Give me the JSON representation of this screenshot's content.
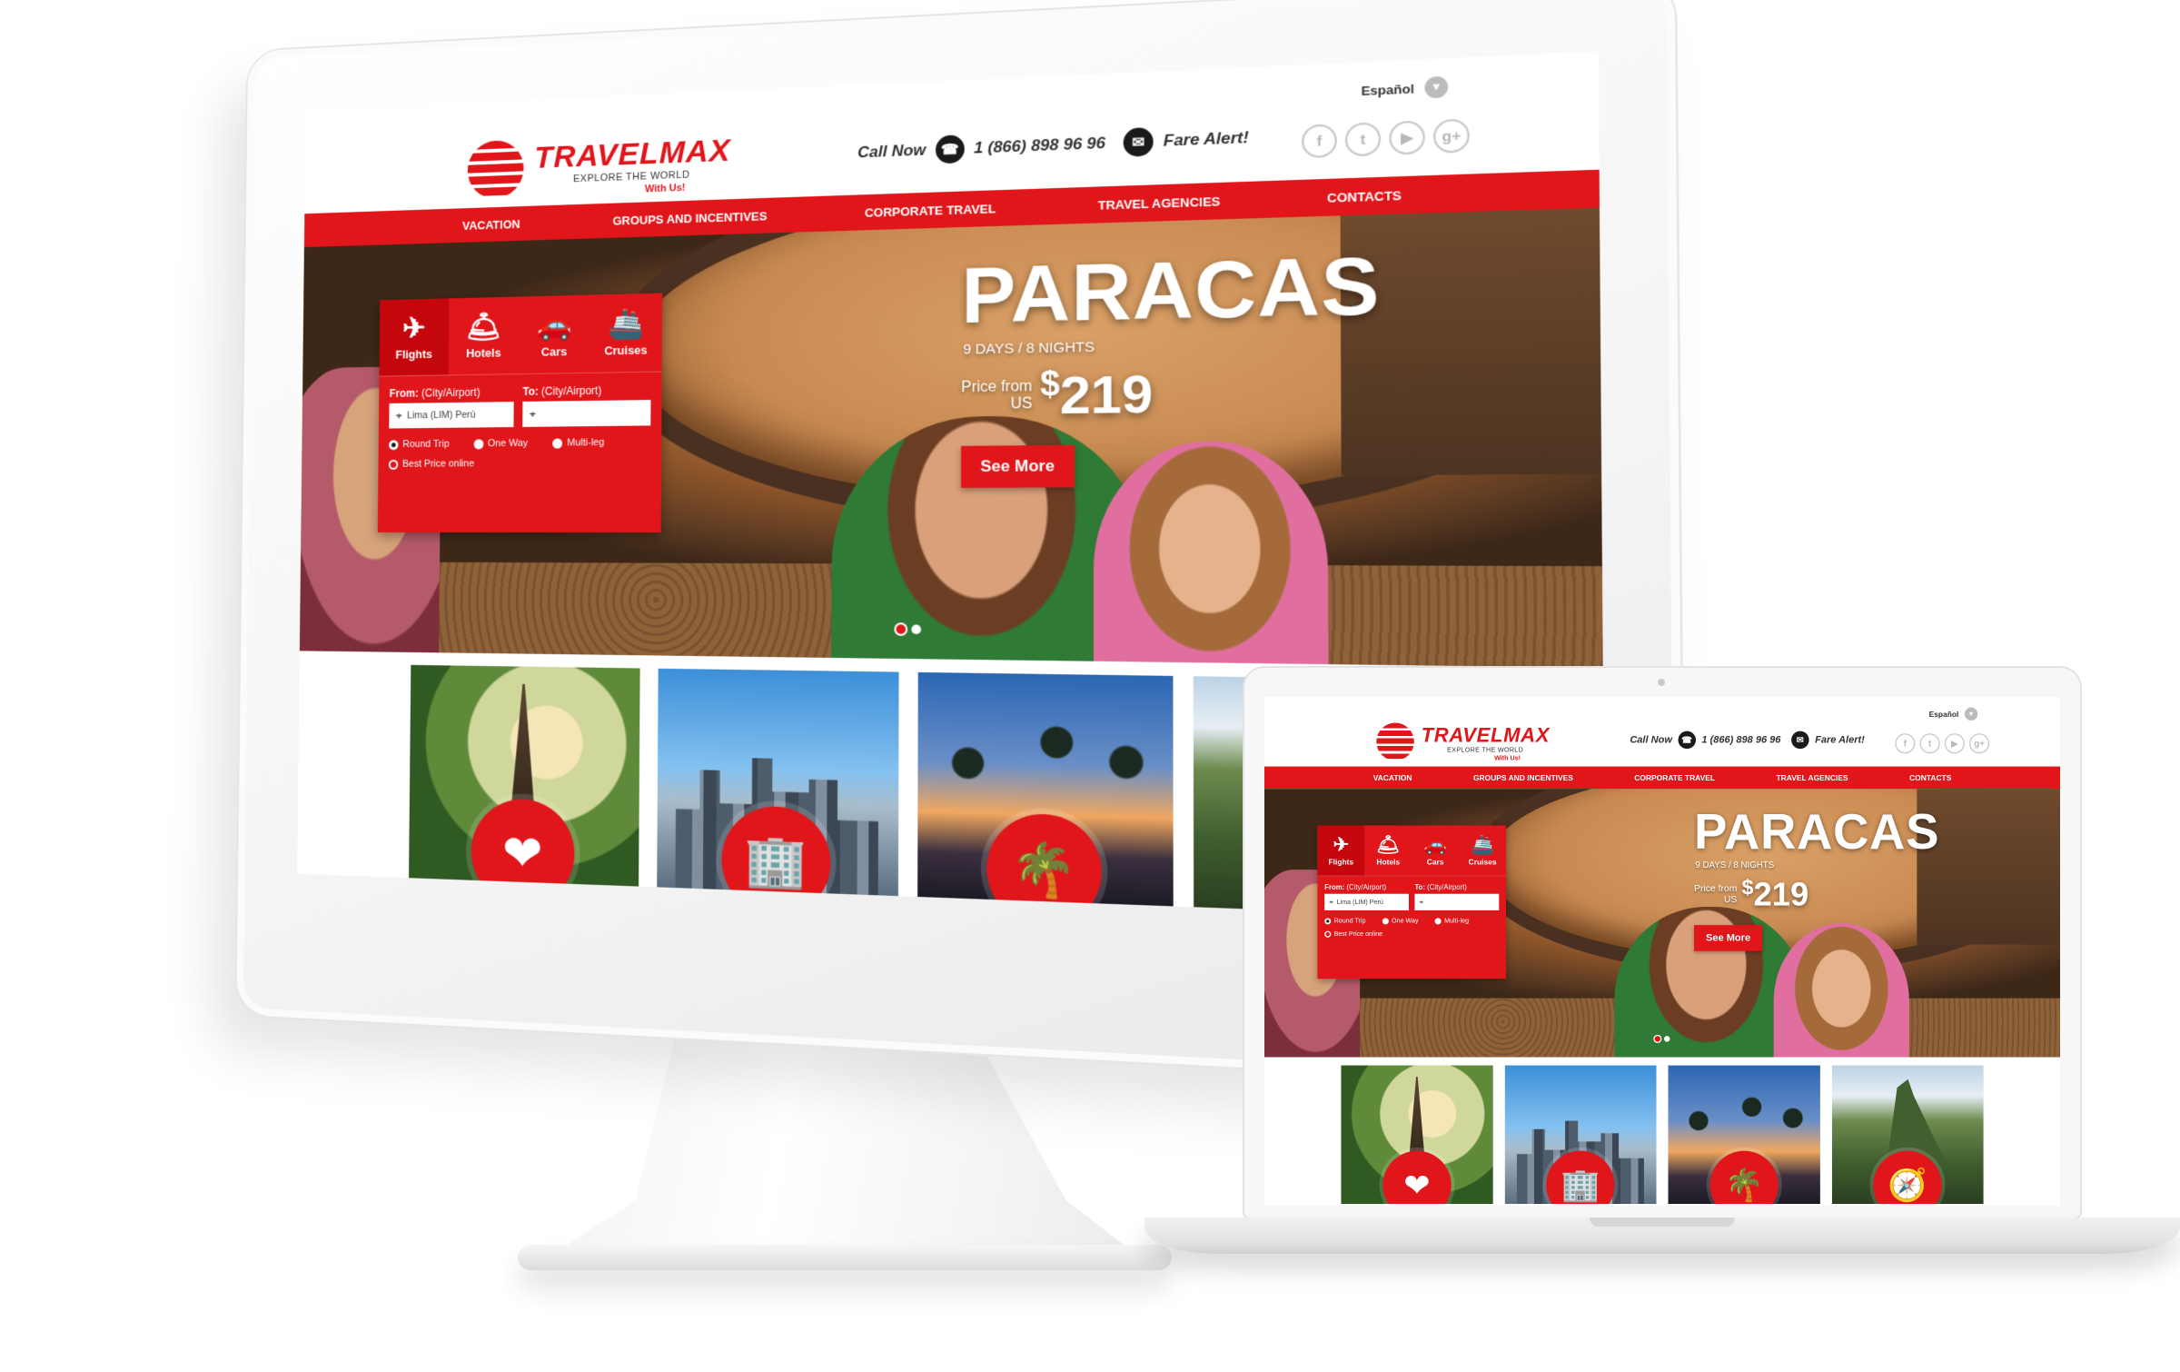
{
  "site": {
    "brand": "TRAVELMAX",
    "tagline": "EXPLORE THE WORLD",
    "tagline_suffix": "With Us!",
    "language": "Español",
    "call_label": "Call Now",
    "phone": "1 (866) 898 96 96",
    "fare_alert": "Fare Alert!",
    "socials": [
      "f",
      "t",
      "▶",
      "g+"
    ],
    "nav": [
      "VACATION",
      "GROUPS AND INCENTIVES",
      "CORPORATE TRAVEL",
      "TRAVEL AGENCIES",
      "CONTACTS"
    ],
    "hero": {
      "destination": "PARACAS",
      "duration": "9 DAYS / 8 NIGHTS",
      "price_prefix": "Price from",
      "currency_code": "US",
      "currency_symbol": "$",
      "price": "219",
      "cta": "See More"
    },
    "search": {
      "tabs": [
        {
          "label": "Flights",
          "icon": "plane-icon",
          "glyph": "✈",
          "active": true
        },
        {
          "label": "Hotels",
          "icon": "bell-icon",
          "glyph": "🛎",
          "active": false
        },
        {
          "label": "Cars",
          "icon": "car-icon",
          "glyph": "🚗",
          "active": false
        },
        {
          "label": "Cruises",
          "icon": "ship-icon",
          "glyph": "🚢",
          "active": false
        }
      ],
      "from_label": "From:",
      "from_hint": "(City/Airport)",
      "from_value": "Lima (LIM) Perú",
      "to_label": "To:",
      "to_hint": "(City/Airport)",
      "to_value": "",
      "trip_types": [
        "Round Trip",
        "One Way",
        "Multi-leg"
      ],
      "selected_trip": "Round Trip",
      "best_price": "Best Price online"
    },
    "slides": {
      "count": 2,
      "active": 1
    },
    "cards": [
      {
        "name": "paris",
        "icon": "hearts-icon",
        "glyph": "❤"
      },
      {
        "name": "new-york",
        "icon": "building-icon",
        "glyph": "🏢"
      },
      {
        "name": "beach",
        "icon": "palm-tree-icon",
        "glyph": "🌴"
      },
      {
        "name": "machu-picchu",
        "icon": "compass-icon",
        "glyph": "🧭"
      }
    ],
    "colors": {
      "brand_red": "#e0161b",
      "dark_red": "#c4070c"
    }
  }
}
